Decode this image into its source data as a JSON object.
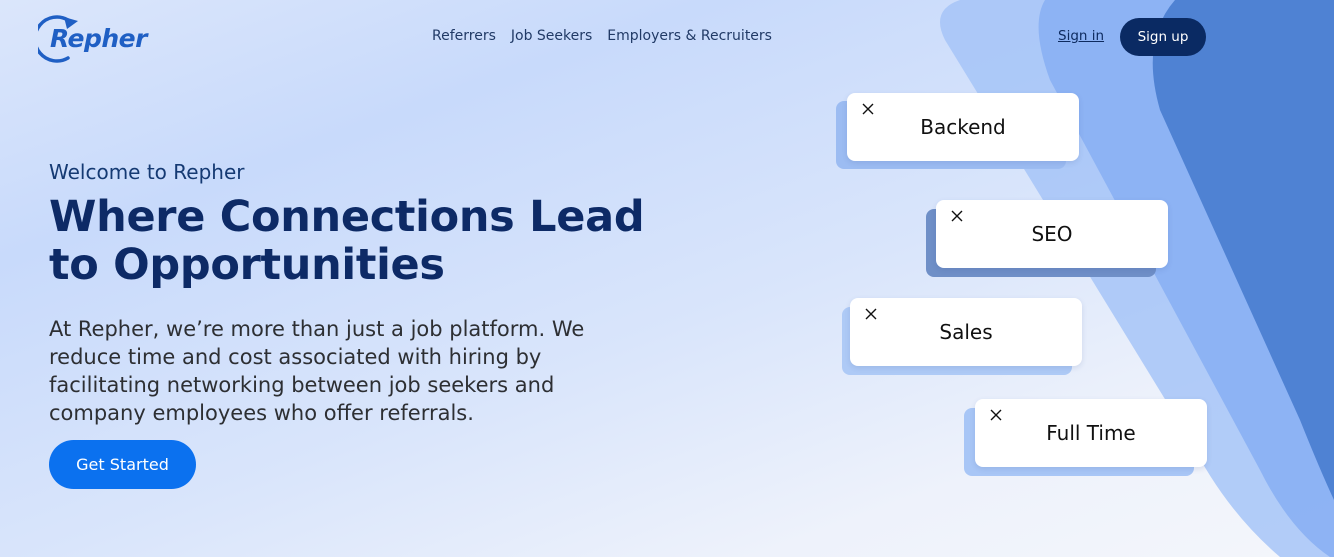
{
  "brand": {
    "name": "Repher"
  },
  "nav": {
    "links": [
      "Referrers",
      "Job Seekers",
      "Employers & Recruiters"
    ]
  },
  "auth": {
    "sign_in": "Sign in",
    "sign_up": "Sign up"
  },
  "hero": {
    "welcome": "Welcome to Repher",
    "headline": "Where Connections Lead to Opportunities",
    "description": "At Repher, we’re more than just a job platform. We reduce time and cost associated with hiring by facilitating networking between job seekers and company employees who offer referrals.",
    "cta": "Get Started"
  },
  "tags": [
    {
      "label": "Backend",
      "icon": "close-icon"
    },
    {
      "label": "SEO",
      "icon": "close-icon"
    },
    {
      "label": "Sales",
      "icon": "close-icon"
    },
    {
      "label": "Full Time",
      "icon": "close-icon"
    }
  ],
  "colors": {
    "brand_blue": "#1f5fc4",
    "navy": "#0a2a63",
    "cta_blue": "#0b71ef",
    "headline": "#0d2a66"
  }
}
